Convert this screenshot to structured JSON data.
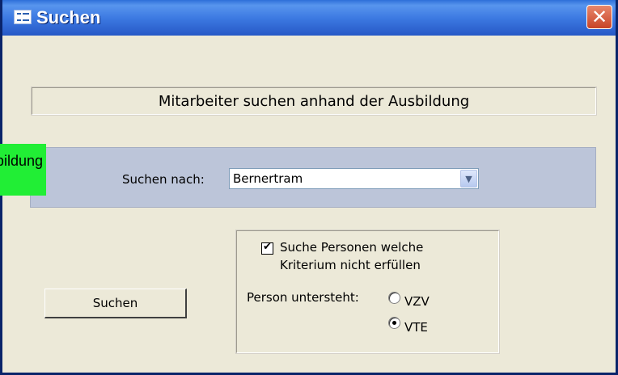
{
  "window": {
    "title": "Suchen",
    "icon": "form-icon",
    "close_glyph": "✕"
  },
  "header": {
    "text": "Mitarbeiter suchen anhand der Ausbildung"
  },
  "overlay": {
    "text": "Suchen nach Ausbildung",
    "color": "#21ee35"
  },
  "search": {
    "label": "Suchen nach:",
    "value": "Bernertram",
    "dropdown_glyph": "▼"
  },
  "actions": {
    "suchen_label": "Suchen"
  },
  "options": {
    "checkbox_checked": true,
    "checkbox_glyph": "✔",
    "checkbox_label_line1": "Suche Personen welche",
    "checkbox_label_line2": "Kriterium nicht erfüllen",
    "untersteht_label": "Person untersteht:",
    "radio_options": [
      {
        "label": "VZV",
        "selected": false
      },
      {
        "label": "VTE",
        "selected": true
      }
    ]
  },
  "colors": {
    "titlebar": "#2658c6",
    "dialog_bg": "#ece9d8",
    "search_band": "#bcc5d9",
    "close_button": "#c84428"
  }
}
